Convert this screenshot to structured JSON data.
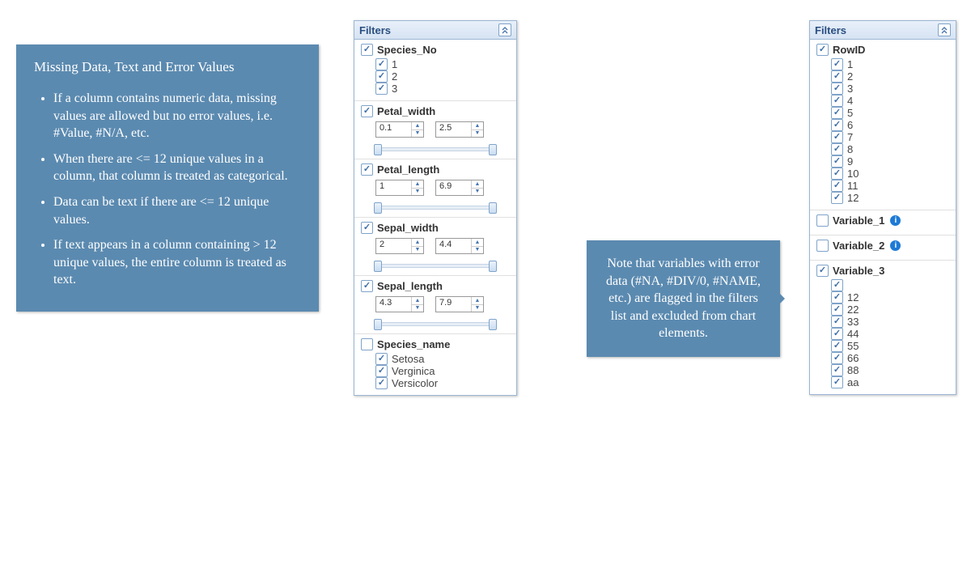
{
  "calloutLeft": {
    "title": "Missing Data, Text and Error Values",
    "bullets": [
      "If a column contains numeric data, missing values are allowed but no error values, i.e. #Value, #N/A, etc.",
      "When there are <= 12 unique values in a column, that column is treated as categorical.",
      "Data can be text if there are <= 12 unique values.",
      "If text appears in a column containing > 12 unique values, the entire column is treated as text."
    ]
  },
  "calloutMid": "Note that variables with error data (#NA, #DIV/0, #NAME, etc.) are flagged in the filters list and excluded from chart elements.",
  "panel1": {
    "title": "Filters",
    "filters": [
      {
        "name": "Species_No",
        "checked": true,
        "type": "cat",
        "items": [
          {
            "v": "1",
            "c": true
          },
          {
            "v": "2",
            "c": true
          },
          {
            "v": "3",
            "c": true
          }
        ]
      },
      {
        "name": "Petal_width",
        "checked": true,
        "type": "range",
        "min": "0.1",
        "max": "2.5"
      },
      {
        "name": "Petal_length",
        "checked": true,
        "type": "range",
        "min": "1",
        "max": "6.9"
      },
      {
        "name": "Sepal_width",
        "checked": true,
        "type": "range",
        "min": "2",
        "max": "4.4"
      },
      {
        "name": "Sepal_length",
        "checked": true,
        "type": "range",
        "min": "4.3",
        "max": "7.9"
      },
      {
        "name": "Species_name",
        "checked": false,
        "type": "cat",
        "items": [
          {
            "v": "Setosa",
            "c": true
          },
          {
            "v": "Verginica",
            "c": true
          },
          {
            "v": "Versicolor",
            "c": true
          }
        ]
      }
    ]
  },
  "panel2": {
    "title": "Filters",
    "filters": [
      {
        "name": "RowID",
        "checked": true,
        "type": "cat",
        "items": [
          {
            "v": "1",
            "c": true
          },
          {
            "v": "2",
            "c": true
          },
          {
            "v": "3",
            "c": true
          },
          {
            "v": "4",
            "c": true
          },
          {
            "v": "5",
            "c": true
          },
          {
            "v": "6",
            "c": true
          },
          {
            "v": "7",
            "c": true
          },
          {
            "v": "8",
            "c": true
          },
          {
            "v": "9",
            "c": true
          },
          {
            "v": "10",
            "c": true
          },
          {
            "v": "11",
            "c": true
          },
          {
            "v": "12",
            "c": true
          }
        ]
      },
      {
        "name": "Variable_1",
        "checked": false,
        "type": "flag",
        "info": true
      },
      {
        "name": "Variable_2",
        "checked": false,
        "type": "flag",
        "info": true
      },
      {
        "name": "Variable_3",
        "checked": true,
        "type": "cat",
        "items": [
          {
            "v": "",
            "c": true
          },
          {
            "v": "12",
            "c": true
          },
          {
            "v": "22",
            "c": true
          },
          {
            "v": "33",
            "c": true
          },
          {
            "v": "44",
            "c": true
          },
          {
            "v": "55",
            "c": true
          },
          {
            "v": "66",
            "c": true
          },
          {
            "v": "88",
            "c": true
          },
          {
            "v": "aa",
            "c": true
          }
        ]
      }
    ]
  }
}
